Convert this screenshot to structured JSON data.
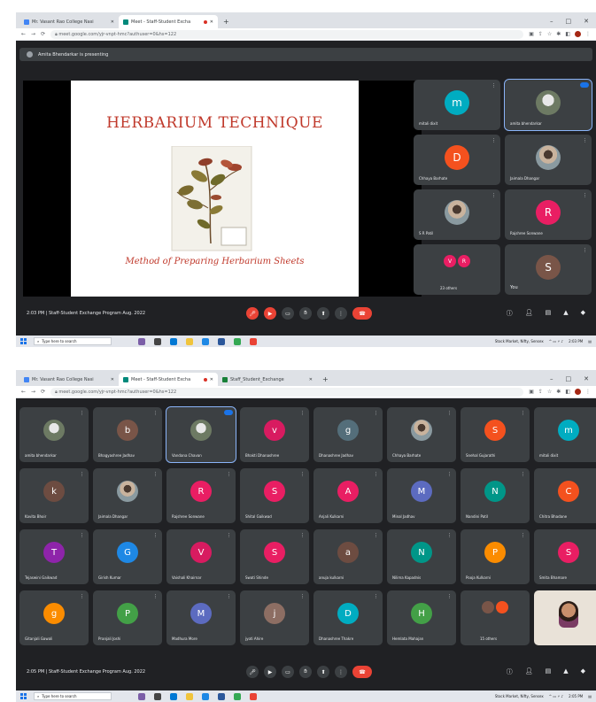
{
  "shot1": {
    "tabs": [
      {
        "label": "Mr. Vasant Rao College Nasi"
      },
      {
        "label": "Meet - Staff-Student Excha"
      }
    ],
    "url": "meet.google.com/yjr-vnpt-hmc?authuser=0&hs=122",
    "banner": "Amita Bhendarkar is presenting",
    "slide": {
      "title": "HERBARIUM TECHNIQUE",
      "subtitle": "Method of Preparing Herbarium Sheets"
    },
    "participants": [
      {
        "initial": "m",
        "name": "mitali dixit",
        "color": "#00acc1"
      },
      {
        "initial": "",
        "name": "amita bhendarkar",
        "color": ""
      },
      {
        "initial": "D",
        "name": "Chhaya Barhate",
        "color": "#f4511e"
      },
      {
        "initial": "",
        "name": "Jaimala Dhangar",
        "color": ""
      },
      {
        "initial": "",
        "name": "S R Patil",
        "color": ""
      },
      {
        "initial": "R",
        "name": "Rajshree Sonwane",
        "color": "#e91e63"
      }
    ],
    "others": {
      "label": "23 others",
      "initials": [
        "V",
        "R"
      ]
    },
    "you": {
      "initial": "S",
      "label": "You"
    },
    "meeting_info": "2:03 PM | Staff-Student Exchange Program Aug. 2022",
    "taskbar": {
      "search": "Type here to search",
      "news": "Stock Market, Nifty, Sensex",
      "time": "2:03 PM"
    }
  },
  "shot2": {
    "tabs": [
      {
        "label": "Mr. Vasant Rao College Nasi"
      },
      {
        "label": "Meet - Staff-Student Excha"
      },
      {
        "label": "Staff_Student_Exchange"
      }
    ],
    "url": "meet.google.com/yjr-vnpt-hmc?authuser=0&hs=122",
    "participants": [
      {
        "initial": "",
        "name": "amita bhendarkar",
        "color": "photo"
      },
      {
        "initial": "b",
        "name": "Bhagyashree Jadhav",
        "color": "#795548"
      },
      {
        "initial": "",
        "name": "Vandana Chavan",
        "color": "photo"
      },
      {
        "initial": "v",
        "name": "Bhakti Dhanashree",
        "color": "#d81b60"
      },
      {
        "initial": "g",
        "name": "Dhanashree Jadhav",
        "color": "#546e7a"
      },
      {
        "initial": "",
        "name": "Chhaya Barhate",
        "color": "person"
      },
      {
        "initial": "S",
        "name": "Snehal Gujarathi",
        "color": "#f4511e"
      },
      {
        "initial": "m",
        "name": "mitali dixit",
        "color": "#00acc1"
      },
      {
        "initial": "k",
        "name": "Kavita Bhoir",
        "color": "#6d4c41"
      },
      {
        "initial": "",
        "name": "Jaimala Dhangar",
        "color": "person"
      },
      {
        "initial": "R",
        "name": "Rajshree Sonwane",
        "color": "#e91e63"
      },
      {
        "initial": "S",
        "name": "Shital Gaikwad",
        "color": "#e91e63"
      },
      {
        "initial": "A",
        "name": "Anjali Kulkarni",
        "color": "#e91e63"
      },
      {
        "initial": "M",
        "name": "Minal Jadhav",
        "color": "#5c6bc0"
      },
      {
        "initial": "N",
        "name": "Nandini Patil",
        "color": "#009688"
      },
      {
        "initial": "C",
        "name": "Chitra Bhadane",
        "color": "#f4511e"
      },
      {
        "initial": "T",
        "name": "Tejaswini Gaikwad",
        "color": "#8e24aa"
      },
      {
        "initial": "G",
        "name": "Girish Kumar",
        "color": "#1e88e5"
      },
      {
        "initial": "V",
        "name": "Vaishali Khairnar",
        "color": "#d81b60"
      },
      {
        "initial": "S",
        "name": "Swati Shinde",
        "color": "#e91e63"
      },
      {
        "initial": "a",
        "name": "anuja kulkarni",
        "color": "#6d4c41"
      },
      {
        "initial": "N",
        "name": "Nilima Kapadnis",
        "color": "#009688"
      },
      {
        "initial": "P",
        "name": "Pooja Kulkarni",
        "color": "#fb8c00"
      },
      {
        "initial": "S",
        "name": "Smita Bhamare",
        "color": "#e91e63"
      },
      {
        "initial": "g",
        "name": "Gitanjali Gawali",
        "color": "#fb8c00"
      },
      {
        "initial": "P",
        "name": "Pranjali Joshi",
        "color": "#43a047"
      },
      {
        "initial": "M",
        "name": "Madhura More",
        "color": "#5c6bc0"
      },
      {
        "initial": "j",
        "name": "jyoti Ahire",
        "color": "#8d6e63"
      },
      {
        "initial": "D",
        "name": "Dhanashree Thakre",
        "color": "#00acc1"
      },
      {
        "initial": "H",
        "name": "Hemlata Mahajan",
        "color": "#43a047"
      }
    ],
    "others": {
      "label": "15 others"
    },
    "meeting_info": "2:05 PM | Staff-Student Exchange Program Aug. 2022",
    "taskbar": {
      "search": "Type here to search",
      "news": "Stock Market, Nifty, Sensex",
      "time": "2:05 PM"
    }
  },
  "colors": {
    "meet_bg": "#202124",
    "tile_bg": "#3c4043",
    "end_call": "#ea4335",
    "slide_title": "#c0392b"
  }
}
